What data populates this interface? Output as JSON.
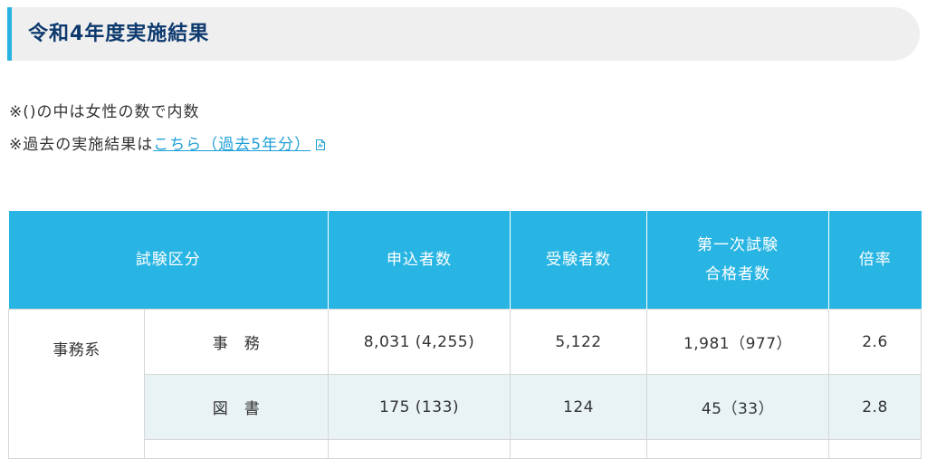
{
  "heading": {
    "title": "令和4年度実施結果"
  },
  "notes": {
    "note1": "※()の中は女性の数で内数",
    "note2_prefix": "※過去の実施結果は",
    "note2_link": "こちら（過去5年分）"
  },
  "table": {
    "headers": {
      "category": "試験区分",
      "applicants": "申込者数",
      "examinees": "受験者数",
      "passers_line1": "第一次試験",
      "passers_line2": "合格者数",
      "ratio": "倍率"
    },
    "group1": "事務系",
    "rows": [
      {
        "name": "事　務",
        "applicants": "8,031 (4,255)",
        "examinees": "5,122",
        "passers": "1,981（977）",
        "ratio": "2.6"
      },
      {
        "name": "図　書",
        "applicants": "175 (133)",
        "examinees": "124",
        "passers": "45（33）",
        "ratio": "2.8"
      }
    ]
  },
  "colors": {
    "accent": "#29b5e3",
    "heading_text": "#0e3a6e",
    "link": "#1e9fd6",
    "alt_row": "#e9f3f6"
  }
}
